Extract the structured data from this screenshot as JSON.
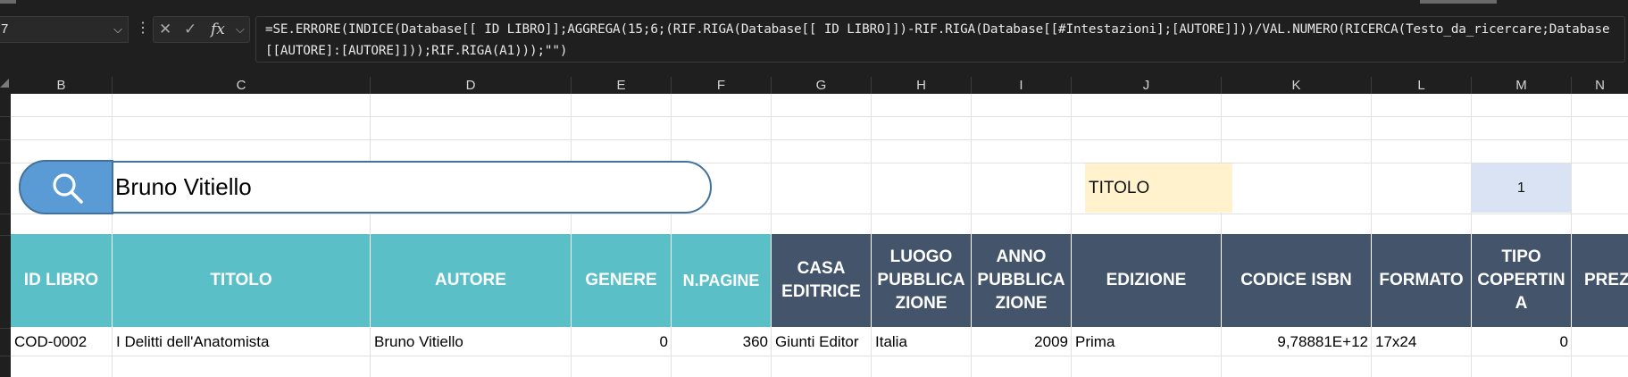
{
  "formula_bar": {
    "name_box": "7",
    "name_box_caret": "⌵",
    "more": "⋮",
    "cancel_icon": "✕",
    "enter_icon": "✓",
    "fx_label": "fx",
    "fx_caret": "⌵",
    "formula": "=SE.ERRORE(INDICE(Database[[ ID LIBRO]];AGGREGA(15;6;(RIF.RIGA(Database[[ ID LIBRO]])-RIF.RIGA(Database[[#Intestazioni];[AUTORE]]))/VAL.NUMERO(RICERCA(Testo_da_ricercare;Database[[AUTORE]:[AUTORE]]));RIF.RIGA(A1)));\"\")"
  },
  "columns": [
    "B",
    "C",
    "D",
    "E",
    "F",
    "G",
    "H",
    "I",
    "J",
    "K",
    "L",
    "M",
    "N"
  ],
  "search": {
    "value": "Bruno Vitiello",
    "icon": "search-icon"
  },
  "side_cells": {
    "titolo_label": "TITOLO",
    "counter": "1"
  },
  "table": {
    "headers": [
      {
        "lines": [
          "ID LIBRO"
        ]
      },
      {
        "lines": [
          "TITOLO"
        ]
      },
      {
        "lines": [
          "AUTORE"
        ]
      },
      {
        "lines": [
          "GENERE"
        ]
      },
      {
        "lines": [
          "N.PAGINE"
        ]
      },
      {
        "lines": [
          "CASA",
          "EDITRICE"
        ]
      },
      {
        "lines": [
          "LUOGO",
          "PUBBLICA",
          "ZIONE"
        ]
      },
      {
        "lines": [
          "ANNO",
          "PUBBLICA",
          "ZIONE"
        ]
      },
      {
        "lines": [
          "EDIZIONE"
        ]
      },
      {
        "lines": [
          "CODICE ISBN"
        ]
      },
      {
        "lines": [
          "FORMATO"
        ]
      },
      {
        "lines": [
          "TIPO",
          "COPERTIN",
          "A"
        ]
      },
      {
        "lines": [
          "PREZ"
        ]
      }
    ],
    "row": [
      "COD-0002",
      "I Delitti dell'Anatomista",
      "Bruno Vitiello",
      "0",
      "360",
      "Giunti Editor",
      "Italia",
      "2009",
      "Prima",
      "9,78881E+12",
      "17x24",
      "0",
      ""
    ]
  },
  "colors": {
    "teal_header": "#5bbfc7",
    "navy_header": "#44546a",
    "search_button": "#5b9bd5",
    "titolo_fill": "#fff2cc",
    "counter_fill": "#dae3f3"
  }
}
